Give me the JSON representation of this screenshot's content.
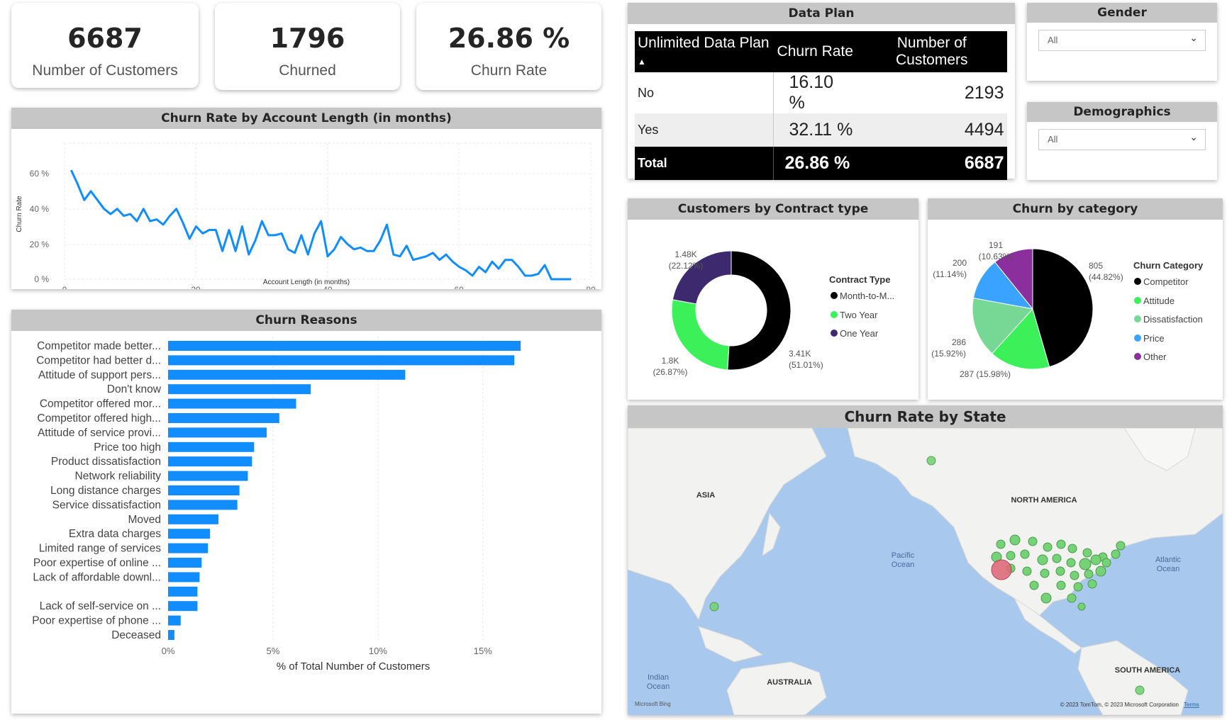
{
  "kpis": {
    "customers": {
      "value": "6687",
      "label": "Number of Customers"
    },
    "churned": {
      "value": "1796",
      "label": "Churned"
    },
    "churn_rate": {
      "value": "26.86 %",
      "label": "Churn Rate"
    }
  },
  "line_chart": {
    "title": "Churn Rate by Account Length (in months)",
    "xlabel": "Account Length (in months)",
    "ylabel": "Churn Rate",
    "x_ticks": [
      "0",
      "20",
      "40",
      "60",
      "80"
    ],
    "y_ticks": [
      "0 %",
      "20 %",
      "40 %",
      "60 %"
    ],
    "color": "#118DFF"
  },
  "data_plan": {
    "title": "Data Plan",
    "headers": [
      "Unlimited Data Plan",
      "Churn Rate",
      "Number of Customers"
    ],
    "rows": [
      {
        "plan": "No",
        "rate": "16.10 %",
        "customers": "2193"
      },
      {
        "plan": "Yes",
        "rate": "32.11 %",
        "customers": "4494"
      }
    ],
    "total": {
      "plan": "Total",
      "rate": "26.86 %",
      "customers": "6687"
    }
  },
  "gender": {
    "title": "Gender",
    "value": "All"
  },
  "demographics": {
    "title": "Demographics",
    "value": "All"
  },
  "contract_chart": {
    "title": "Customers by Contract type",
    "legend_title": "Contract Type",
    "legend": [
      "Month-to-M...",
      "Two Year",
      "One Year"
    ],
    "labels": [
      {
        "v": "3.41K",
        "p": "(51.01%)"
      },
      {
        "v": "1.8K",
        "p": "(26.87%)"
      },
      {
        "v": "1.48K",
        "p": "(22.12%)"
      }
    ]
  },
  "category_chart": {
    "title": "Churn by category",
    "legend_title": "Churn Category",
    "legend": [
      "Competitor",
      "Attitude",
      "Dissatisfaction",
      "Price",
      "Other"
    ],
    "labels": [
      {
        "v": "805",
        "p": "(44.82%)"
      },
      {
        "v": "287 (15.98%)",
        "p": ""
      },
      {
        "v": "286",
        "p": "(15.92%)"
      },
      {
        "v": "200",
        "p": "(11.14%)"
      },
      {
        "v": "191",
        "p": "(10.63%)"
      }
    ]
  },
  "reasons_chart": {
    "title": "Churn Reasons",
    "xlabel": "% of Total Number of Customers",
    "x_ticks": [
      "0%",
      "5%",
      "10%",
      "15%"
    ],
    "color": "#118DFF"
  },
  "map": {
    "title": "Churn Rate by State",
    "labels": {
      "asia": "ASIA",
      "north_america": "NORTH AMERICA",
      "pacific": "Pacific",
      "pacific2": "Ocean",
      "atlantic": "Atlantic",
      "atlantic2": "Ocean",
      "indian": "Indian",
      "indian2": "Ocean",
      "australia": "AUSTRALIA",
      "south_america": "SOUTH AMERICA"
    },
    "copyright": "© 2023 TomTom, © 2023 Microsoft Corporation",
    "terms": "Terms",
    "bing": "Microsoft Bing"
  },
  "chart_data": [
    {
      "type": "line",
      "title": "Churn Rate by Account Length (in months)",
      "xlabel": "Account Length (in months)",
      "ylabel": "Churn Rate",
      "xlim": [
        0,
        80
      ],
      "ylim": [
        0,
        0.65
      ],
      "x": [
        1,
        2,
        3,
        4,
        5,
        6,
        7,
        8,
        9,
        10,
        11,
        12,
        13,
        14,
        15,
        16,
        17,
        18,
        19,
        20,
        21,
        22,
        23,
        24,
        25,
        26,
        27,
        28,
        29,
        30,
        31,
        32,
        33,
        34,
        35,
        36,
        37,
        38,
        39,
        40,
        41,
        42,
        43,
        44,
        45,
        46,
        47,
        48,
        49,
        50,
        51,
        52,
        53,
        54,
        55,
        56,
        57,
        58,
        59,
        60,
        61,
        62,
        63,
        64,
        65,
        66,
        67,
        68,
        69,
        70,
        71,
        72,
        73,
        74,
        75,
        76,
        77
      ],
      "y": [
        0.62,
        0.54,
        0.45,
        0.5,
        0.45,
        0.4,
        0.37,
        0.4,
        0.36,
        0.37,
        0.33,
        0.4,
        0.33,
        0.34,
        0.31,
        0.36,
        0.4,
        0.32,
        0.23,
        0.3,
        0.26,
        0.28,
        0.28,
        0.16,
        0.28,
        0.16,
        0.3,
        0.14,
        0.22,
        0.33,
        0.25,
        0.25,
        0.26,
        0.17,
        0.15,
        0.25,
        0.14,
        0.26,
        0.33,
        0.13,
        0.17,
        0.24,
        0.2,
        0.17,
        0.18,
        0.16,
        0.16,
        0.22,
        0.31,
        0.14,
        0.13,
        0.19,
        0.11,
        0.12,
        0.13,
        0.15,
        0.11,
        0.14,
        0.1,
        0.07,
        0.05,
        0.02,
        0.07,
        0.04,
        0.1,
        0.06,
        0.11,
        0.11,
        0.07,
        0.02,
        0.02,
        0.03,
        0.08,
        0.0,
        0.0,
        0.0,
        0.0
      ],
      "series": [
        {
          "name": "Churn Rate"
        }
      ]
    },
    {
      "type": "bar",
      "title": "Churn Reasons",
      "xlabel": "% of Total Number of Customers",
      "xlim": [
        0,
        0.17
      ],
      "categories": [
        "Competitor made better...",
        "Competitor had better d...",
        "Attitude of support pers...",
        "Don't know",
        "Competitor offered mor...",
        "Competitor offered high...",
        "Attitude of service provi...",
        "Price too high",
        "Product dissatisfaction",
        "Network reliability",
        "Long distance charges",
        "Service dissatisfaction",
        "Moved",
        "Extra data charges",
        "Limited range of services",
        "Poor expertise of online ...",
        "Lack of affordable downl...",
        "",
        "Lack of self-service on ...",
        "Poor expertise of phone ...",
        "Deceased"
      ],
      "values": [
        0.168,
        0.165,
        0.113,
        0.068,
        0.061,
        0.053,
        0.047,
        0.041,
        0.04,
        0.038,
        0.034,
        0.033,
        0.024,
        0.02,
        0.019,
        0.016,
        0.015,
        0.014,
        0.014,
        0.006,
        0.003
      ]
    },
    {
      "type": "pie",
      "title": "Customers by Contract type",
      "categories": [
        "Month-to-M...",
        "Two Year",
        "One Year"
      ],
      "values": [
        3410,
        1800,
        1480
      ],
      "colors": [
        "#000000",
        "#3CF05A",
        "#3D2A6E"
      ],
      "donut": true
    },
    {
      "type": "pie",
      "title": "Churn by category",
      "categories": [
        "Competitor",
        "Attitude",
        "Dissatisfaction",
        "Price",
        "Other"
      ],
      "values": [
        805,
        287,
        286,
        200,
        191
      ],
      "colors": [
        "#000000",
        "#3CF05A",
        "#77D794",
        "#3AA3FF",
        "#8B2E9E"
      ]
    }
  ]
}
